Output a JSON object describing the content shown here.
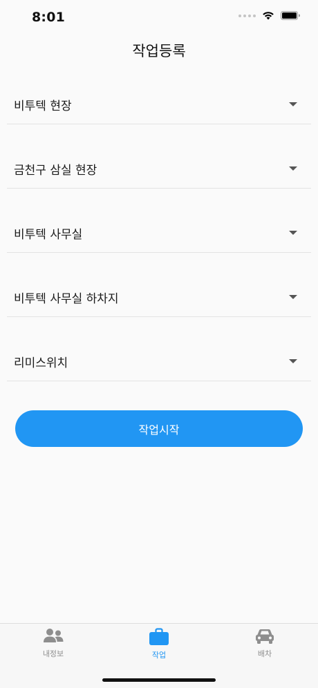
{
  "status_bar": {
    "time": "8:01"
  },
  "header": {
    "title": "작업등록"
  },
  "dropdowns": [
    {
      "value": "비투텍 현장"
    },
    {
      "value": "금천구 삼실 현장"
    },
    {
      "value": "비투텍 사무실"
    },
    {
      "value": "비투텍 사무실 하차지"
    },
    {
      "value": "리미스위치"
    }
  ],
  "start_button": {
    "label": "작업시작"
  },
  "tabs": [
    {
      "label": "내정보",
      "icon": "people-icon"
    },
    {
      "label": "작업",
      "icon": "briefcase-icon",
      "active": true
    },
    {
      "label": "배차",
      "icon": "car-icon"
    }
  ],
  "colors": {
    "accent": "#2196f3",
    "inactive": "#8e8e8e"
  }
}
